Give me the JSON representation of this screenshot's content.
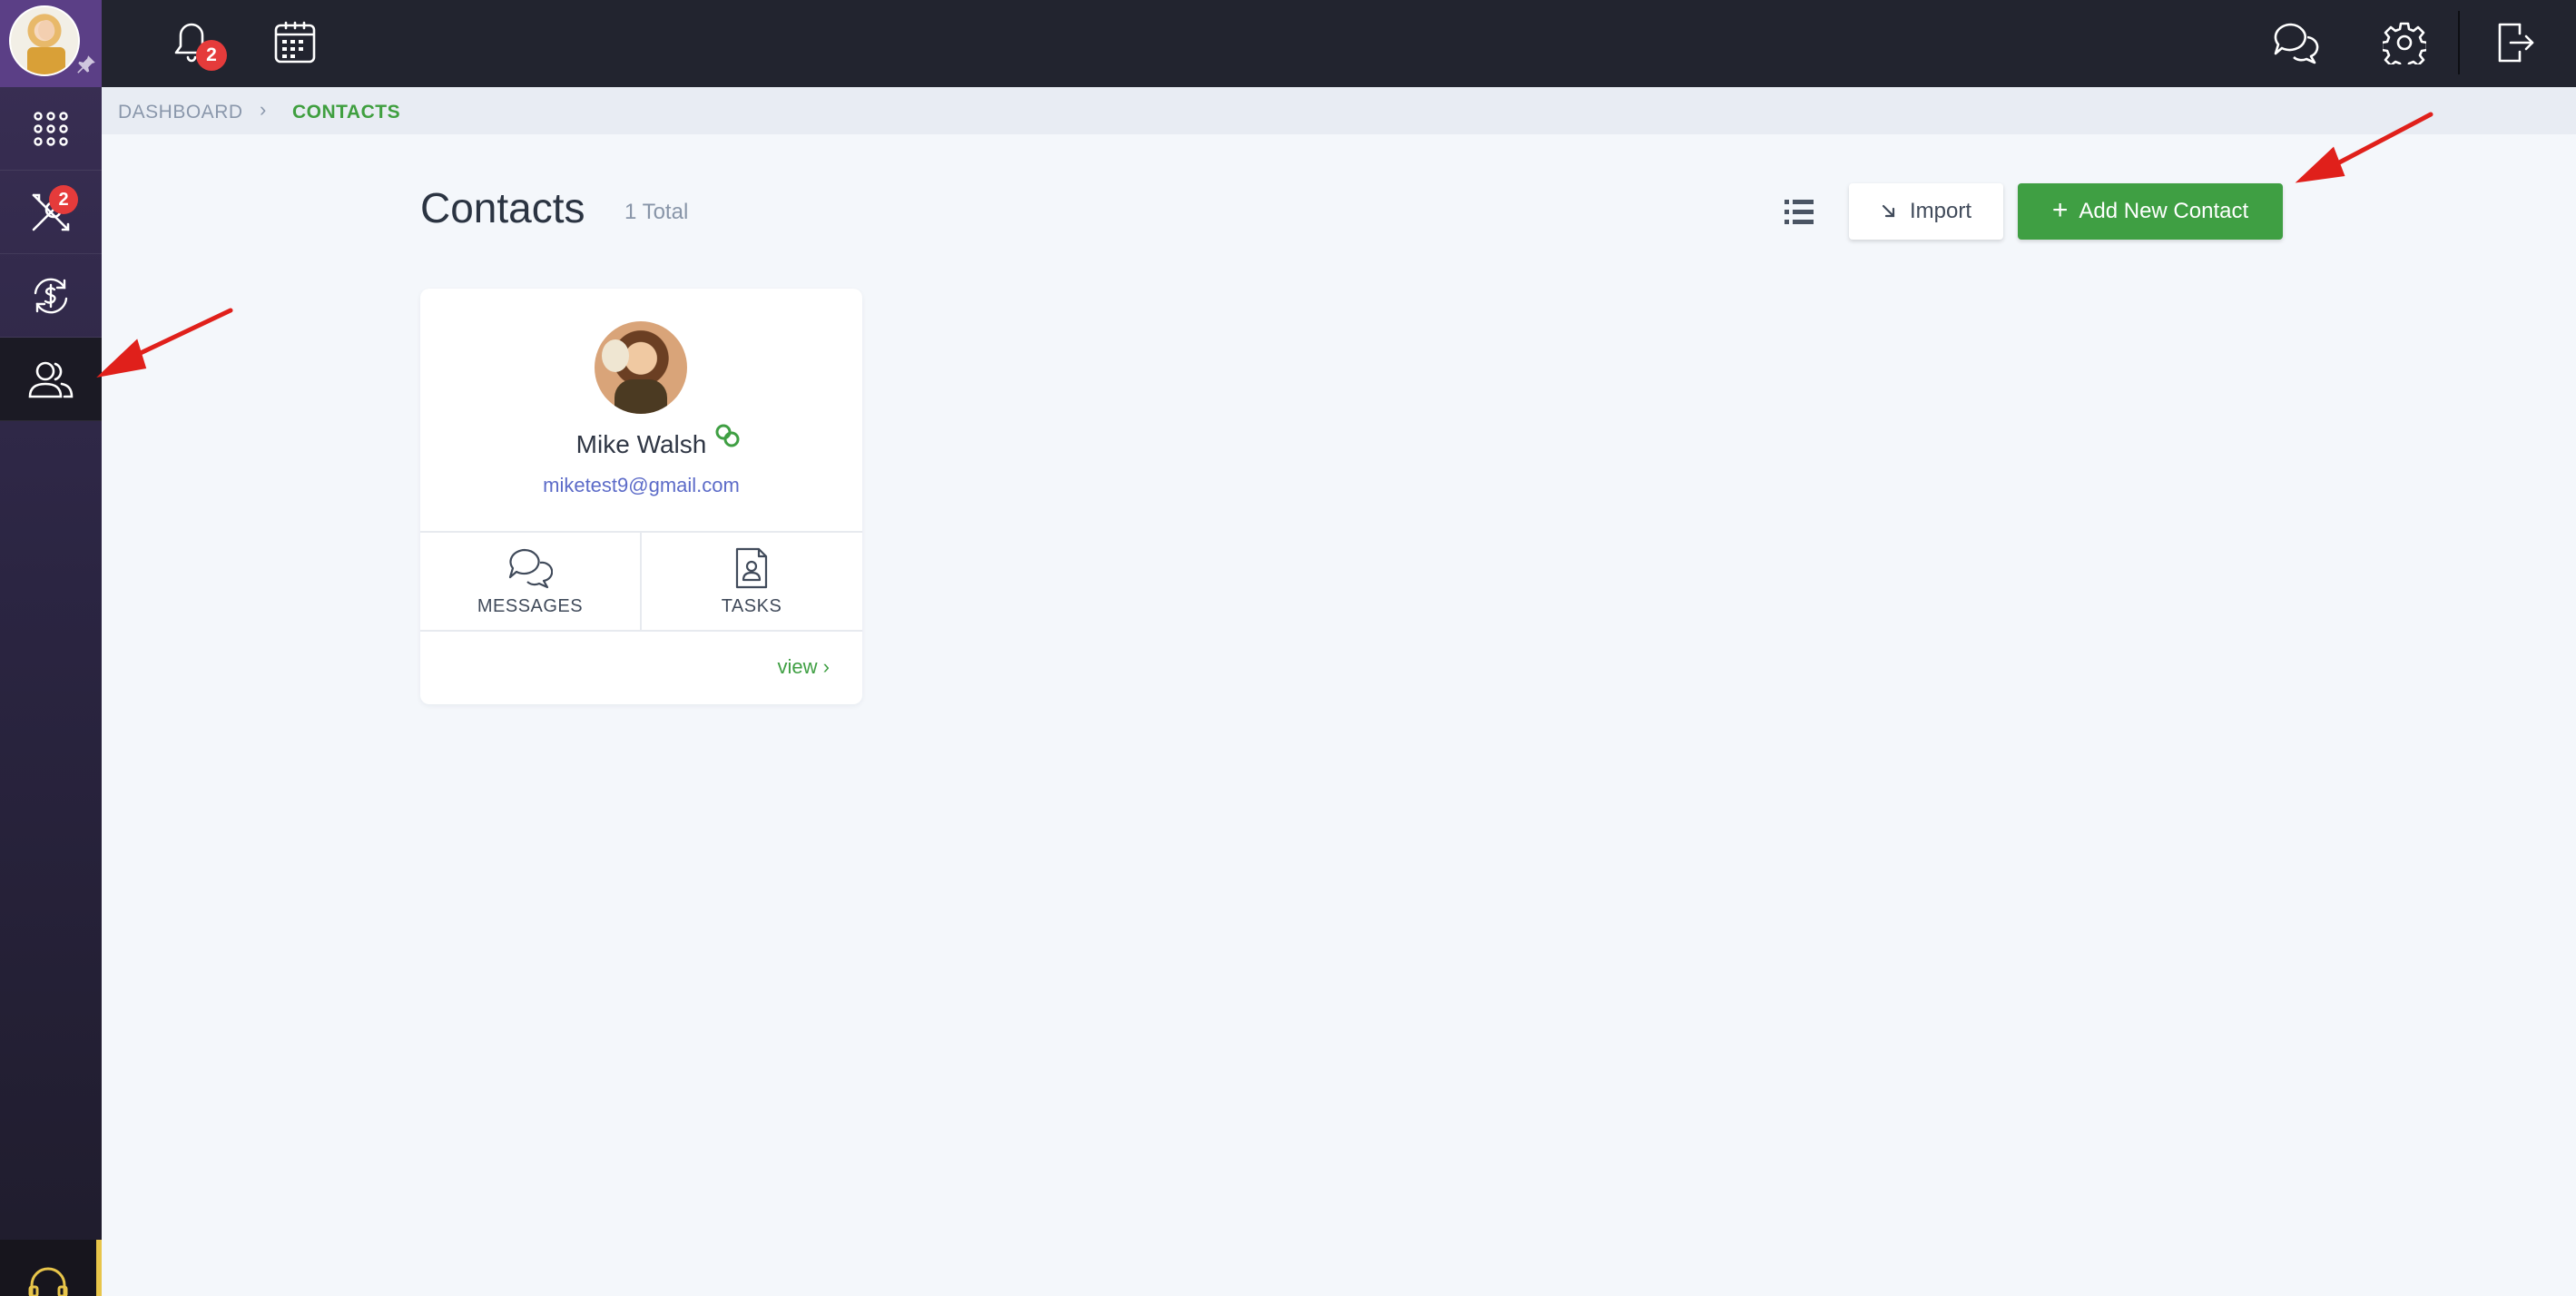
{
  "sidebar": {
    "tools_badge": "2",
    "items": [
      {
        "name": "apps",
        "icon": "grid-icon"
      },
      {
        "name": "tools",
        "icon": "tools-icon"
      },
      {
        "name": "payments",
        "icon": "dollar-cycle-icon"
      },
      {
        "name": "contacts",
        "icon": "users-icon",
        "active": true
      }
    ],
    "support_icon": "headset-icon"
  },
  "topbar": {
    "notifications_badge": "2",
    "icons": [
      "bell-icon",
      "calendar-icon",
      "chat-icon",
      "gear-icon",
      "logout-icon"
    ]
  },
  "breadcrumb": {
    "root": "DASHBOARD",
    "separator": "›",
    "current": "CONTACTS"
  },
  "header": {
    "title": "Contacts",
    "total": "1 Total",
    "import_label": "Import",
    "add_label": "Add New Contact"
  },
  "contact_card": {
    "name": "Mike Walsh",
    "email": "miketest9@gmail.com",
    "messages_label": "MESSAGES",
    "tasks_label": "TASKS",
    "view_label": "view"
  },
  "colors": {
    "accent_green": "#3f9f43",
    "badge_red": "#e53b3b",
    "topbar": "#22242f",
    "email_link": "#5c6bc8",
    "annotation_arrow": "#e0201b"
  }
}
